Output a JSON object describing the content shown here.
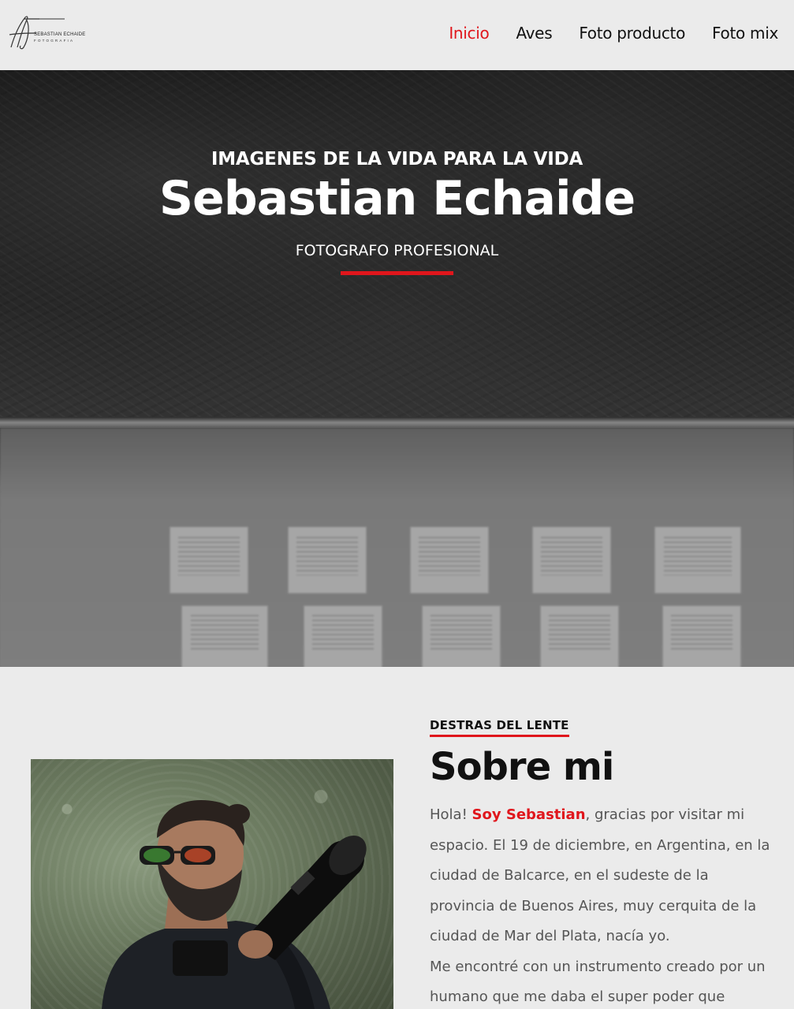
{
  "header": {
    "logo": {
      "name": "SEBASTIAN ECHAIDE",
      "sub": "FOTOGRAFIA"
    },
    "nav": [
      {
        "label": "Inicio",
        "active": true
      },
      {
        "label": "Aves",
        "active": false
      },
      {
        "label": "Foto producto",
        "active": false
      },
      {
        "label": "Foto mix",
        "active": false
      }
    ]
  },
  "hero": {
    "kicker": "IMAGENES DE LA VIDA PARA LA VIDA",
    "title": "Sebastian Echaide",
    "subtitle": "FOTOGRAFO PROFESIONAL"
  },
  "about": {
    "kicker": "DESTRAS DEL LENTE",
    "title": "Sobre mi",
    "p1_before": "Hola! ",
    "p1_highlight": "Soy Sebastian",
    "p1_after": ", gracias por visitar mi espacio. El 19 de diciembre, en Argentina, en la ciudad de Balcarce, en el sudeste de la provincia de Buenos Aires, muy cerquita de la ciudad de Mar del Plata, nacía yo.",
    "p2": "Me encontré con un instrumento creado por un humano que me daba el super poder que"
  },
  "colors": {
    "accent": "#e0161c",
    "background": "#ebebeb"
  }
}
